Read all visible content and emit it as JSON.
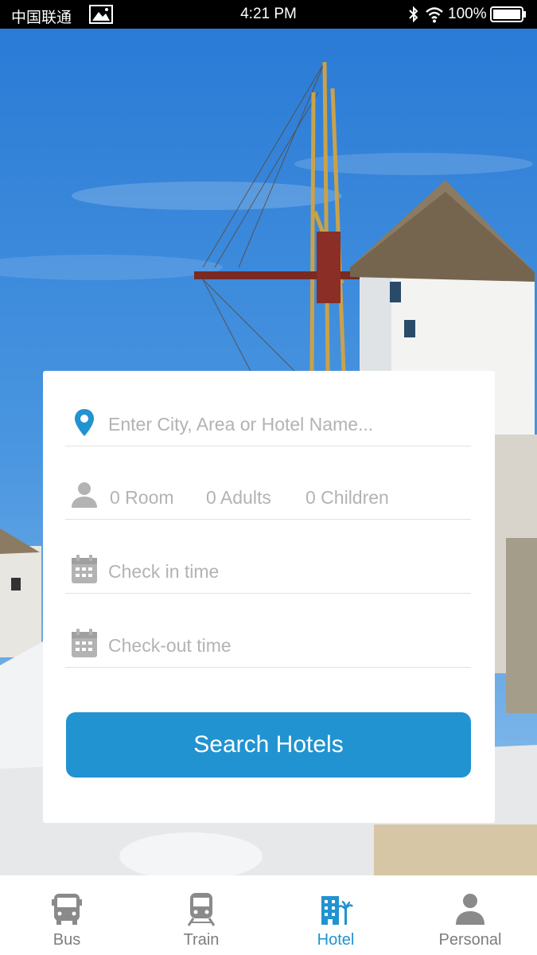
{
  "status_bar": {
    "carrier": "中国联通",
    "time": "4:21 PM",
    "battery": "100%"
  },
  "search_form": {
    "destination_placeholder": "Enter City, Area or Hotel Name...",
    "rooms": "0 Room",
    "adults": "0 Adults",
    "children": "0 Children",
    "check_in_placeholder": "Check in time",
    "check_out_placeholder": "Check-out time",
    "search_button": "Search Hotels"
  },
  "tab_bar": {
    "tabs": [
      {
        "label": "Bus",
        "icon": "bus-icon",
        "active": false
      },
      {
        "label": "Train",
        "icon": "train-icon",
        "active": false
      },
      {
        "label": "Hotel",
        "icon": "hotel-icon",
        "active": true
      },
      {
        "label": "Personal",
        "icon": "person-icon",
        "active": false
      }
    ]
  },
  "colors": {
    "accent": "#2193d0",
    "placeholder": "#b3b3b3",
    "tab_inactive": "#7d7d7d"
  }
}
